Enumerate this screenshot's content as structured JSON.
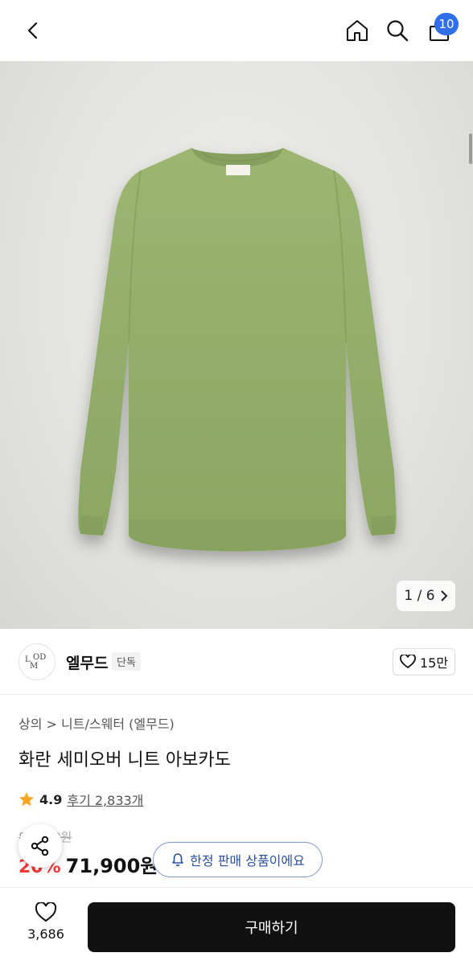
{
  "header": {
    "cart_count": "10",
    "icons": [
      "back-arrow-icon",
      "home-icon",
      "search-icon",
      "shopping-bag-icon"
    ]
  },
  "gallery": {
    "pager": "1 / 6",
    "current": 1,
    "total": 6
  },
  "brand": {
    "logo_text": "LMOD",
    "name": "엘무드",
    "tag": "단독",
    "likes": "15만"
  },
  "product": {
    "breadcrumb": [
      "상의",
      "니트/스웨터 (엘무드)"
    ],
    "title": "화란 세미오버 니트 아보카도",
    "rating": "4.9",
    "reviews": "후기 2,833개",
    "original_price": "89,900원",
    "discount": "20%",
    "price": "71,900원",
    "limited_badge": "한정 판매 상품이에요"
  },
  "bottom": {
    "wish_count": "3,686",
    "buy_label": "구매하기"
  },
  "colors": {
    "accent_blue": "#2f6fe8",
    "discount_red": "#ef3b3b",
    "star": "#f5a623",
    "sweater_green": "#94b06a"
  }
}
